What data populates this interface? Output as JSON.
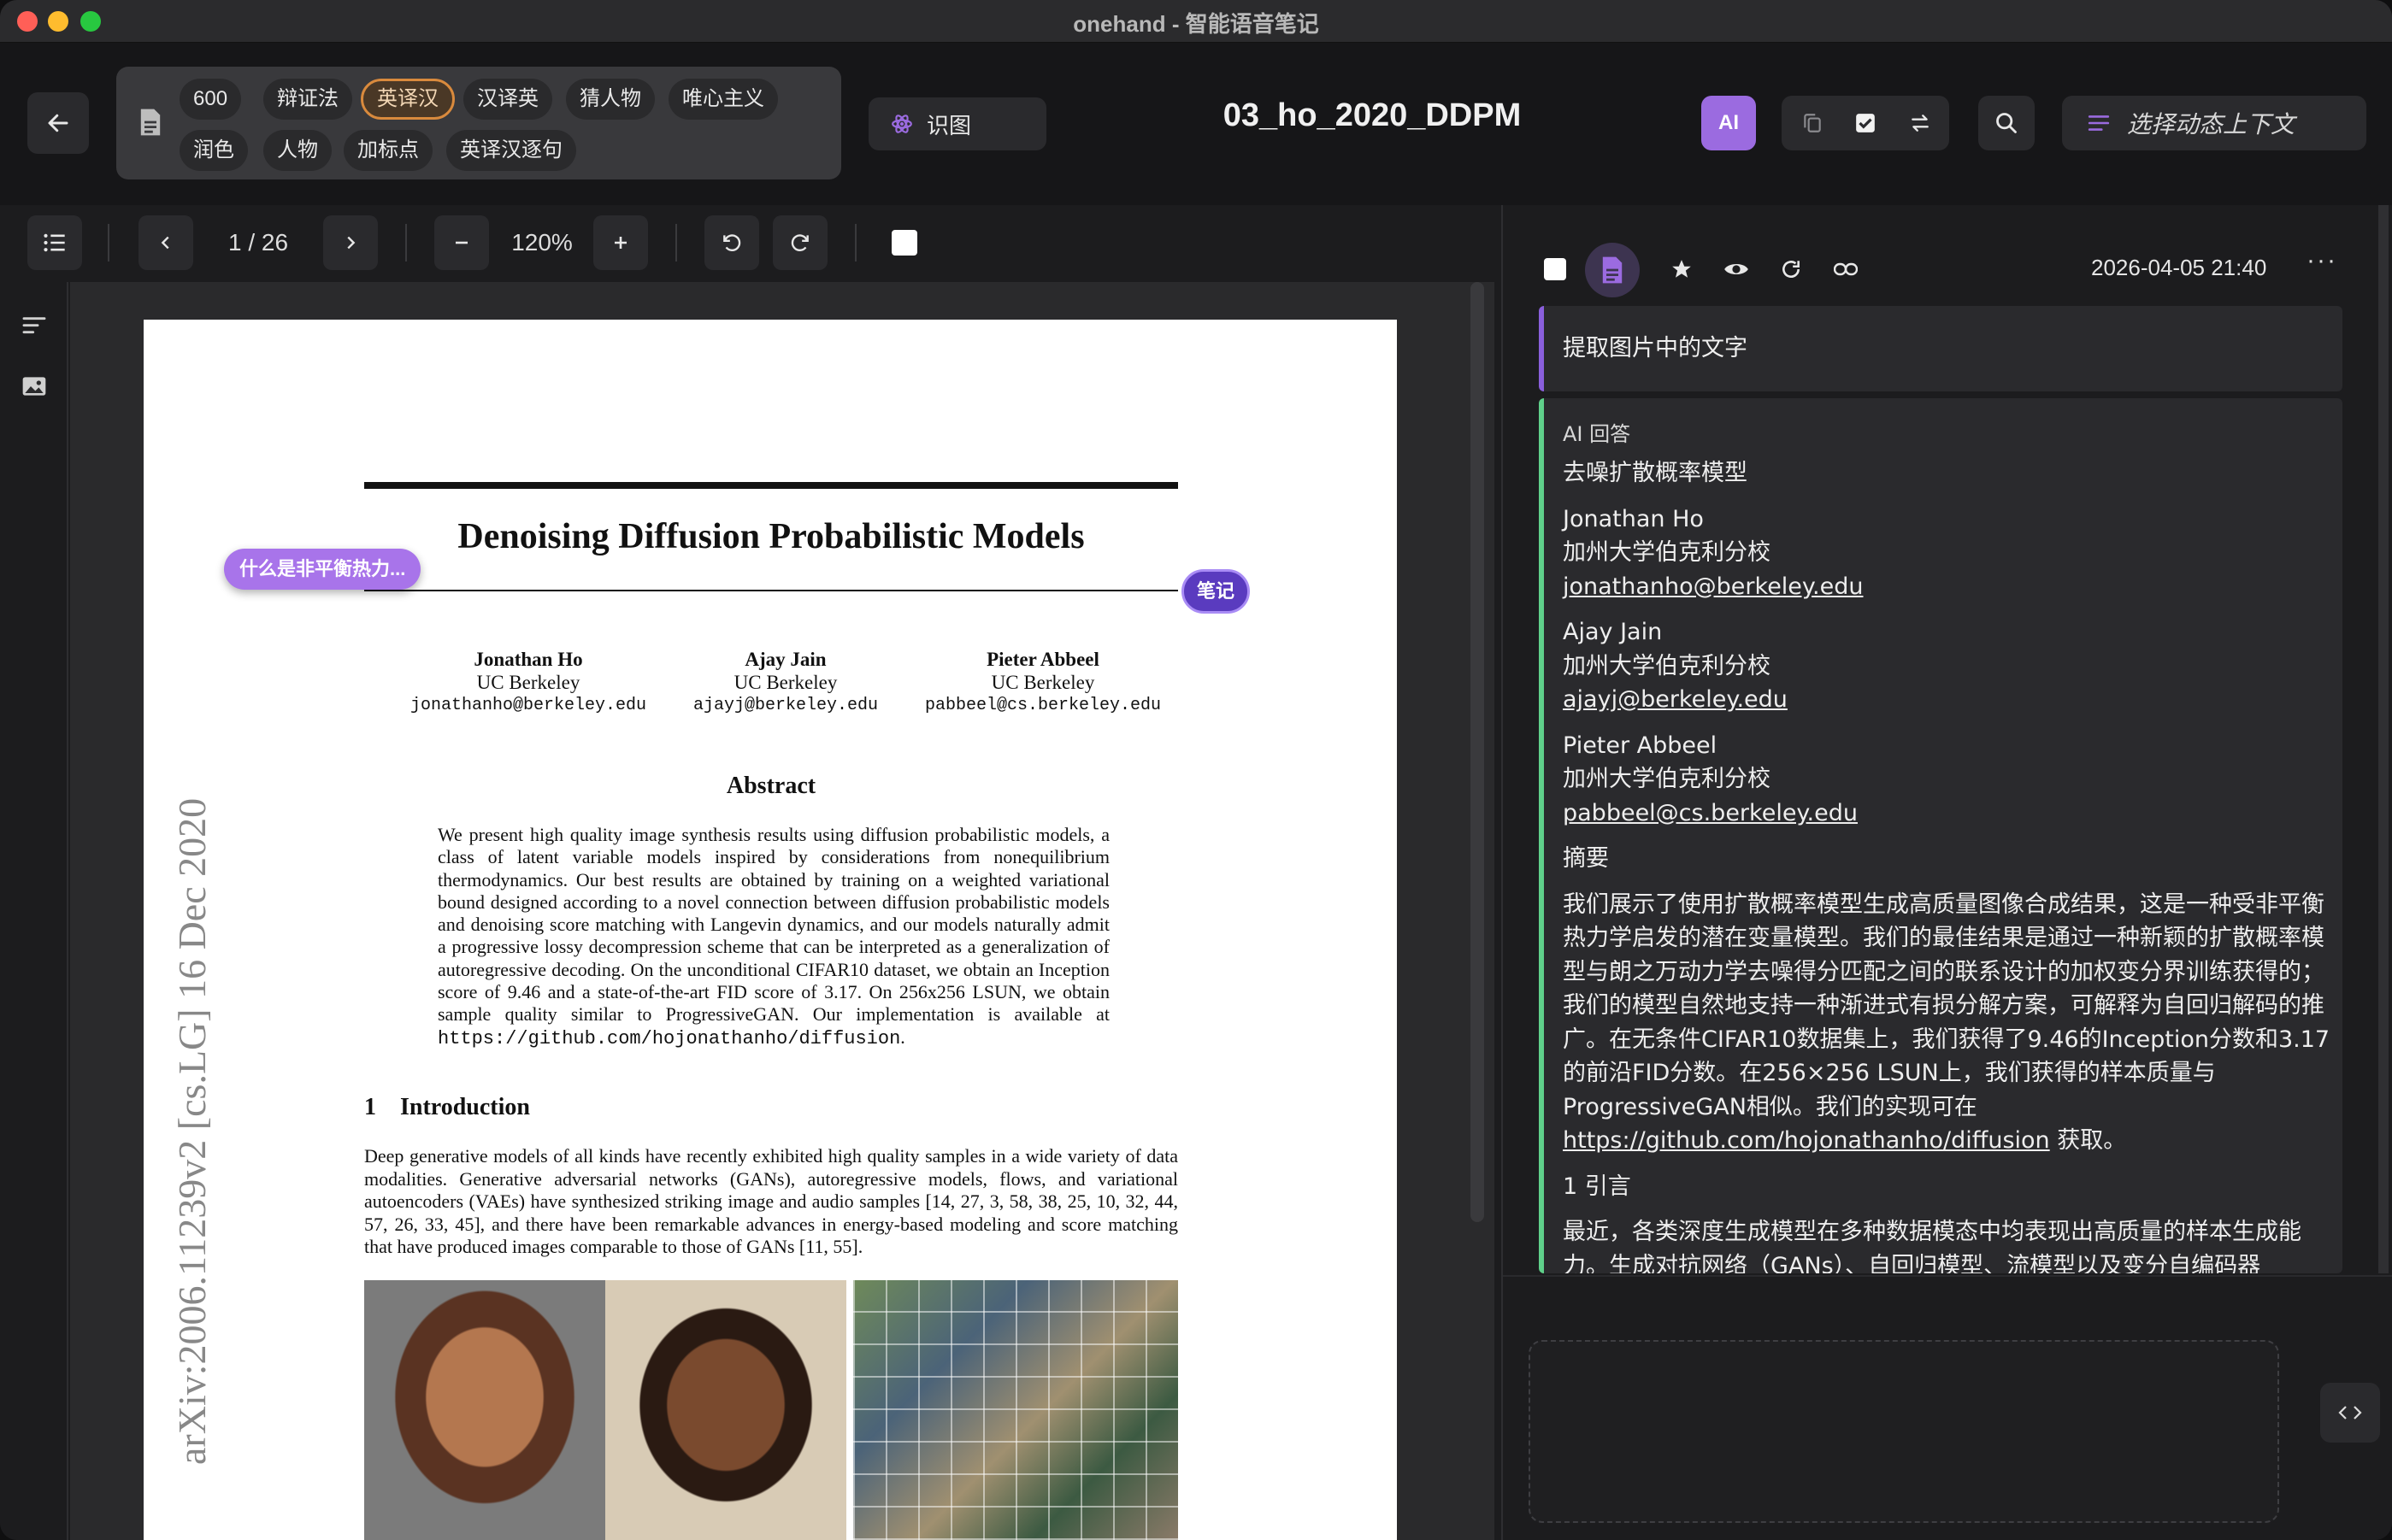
{
  "window": {
    "title": "onehand - 智能语音笔记"
  },
  "header": {
    "chips_row1": [
      "600",
      "辩证法",
      "英译汉",
      "汉译英",
      "猜人物",
      "唯心主义"
    ],
    "chips_row2": [
      "润色",
      "人物",
      "加标点",
      "英译汉逐句"
    ],
    "active_chip": "英译汉",
    "recog_label": "识图",
    "doc_title": "03_ho_2020_DDPM",
    "ai_label": "AI",
    "context_label": "选择动态上下文",
    "accent_color": "#9b6be0"
  },
  "pdf_toolbar": {
    "page_indicator": "1 / 26",
    "zoom": "120%"
  },
  "paper": {
    "title": "Denoising Diffusion Probabilistic Models",
    "authors": [
      {
        "name": "Jonathan Ho",
        "affil": "UC Berkeley",
        "email": "jonathanho@berkeley.edu"
      },
      {
        "name": "Ajay Jain",
        "affil": "UC Berkeley",
        "email": "ajayj@berkeley.edu"
      },
      {
        "name": "Pieter Abbeel",
        "affil": "UC Berkeley",
        "email": "pabbeel@cs.berkeley.edu"
      }
    ],
    "abstract_head": "Abstract",
    "abstract_text": "We present high quality image synthesis results using diffusion probabilistic models, a class of latent variable models inspired by considerations from nonequilibrium thermodynamics. Our best results are obtained by training on a weighted variational bound designed according to a novel connection between diffusion probabilistic models and denoising score matching with Langevin dynamics, and our models naturally admit a progressive lossy decompression scheme that can be interpreted as a generalization of autoregressive decoding. On the unconditional CIFAR10 dataset, we obtain an Inception score of 9.46 and a state-of-the-art FID score of 3.17. On 256x256 LSUN, we obtain sample quality similar to ProgressiveGAN. Our implementation is available at",
    "abstract_url": "https://github.com/hojonathanho/diffusion",
    "intro_head": "1    Introduction",
    "intro_text": "Deep generative models of all kinds have recently exhibited high quality samples in a wide variety of data modalities. Generative adversarial networks (GANs), autoregressive models, flows, and variational autoencoders (VAEs) have synthesized striking image and audio samples [14, 27, 3, 58, 38, 25, 10, 32, 44, 57, 26, 33, 45], and there have been remarkable advances in energy-based modeling and score matching that have produced images comparable to those of GANs [11, 55].",
    "arxiv_stamp": "arXiv:2006.11239v2  [cs.LG]  16 Dec 2020",
    "question_tag": "什么是非平衡热力...",
    "note_tag": "笔记"
  },
  "note_panel": {
    "timestamp": "2026-04-05 21:40",
    "more_label": "···",
    "prompt": "提取图片中的文字",
    "answer_label": "AI 回答",
    "answer": {
      "title": "去噪扩散概率模型",
      "author1_name": "Jonathan Ho",
      "author1_affil": "加州大学伯克利分校",
      "author1_email": "jonathanho@berkeley.edu",
      "author2_name": "Ajay Jain",
      "author2_affil": "加州大学伯克利分校",
      "author2_email": "ajayj@berkeley.edu",
      "author3_name": "Pieter Abbeel",
      "author3_affil": "加州大学伯克利分校",
      "author3_email": "pabbeel@cs.berkeley.edu",
      "abstract_head": "摘要",
      "abstract_text": "我们展示了使用扩散概率模型生成高质量图像合成结果，这是一种受非平衡热力学启发的潜在变量模型。我们的最佳结果是通过一种新颖的扩散概率模型与朗之万动力学去噪得分匹配之间的联系设计的加权变分界训练获得的；我们的模型自然地支持一种渐进式有损分解方案，可解释为自回归解码的推广。在无条件CIFAR10数据集上，我们获得了9.46的Inception分数和3.17的前沿FID分数。在256×256 LSUN上，我们获得的样本质量与ProgressiveGAN相似。我们的实现可在",
      "abstract_url": "https://github.com/hojonathanho/diffusion",
      "abstract_tail": " 获取。",
      "intro_head": "1 引言",
      "intro_text": "最近，各类深度生成模型在多种数据模态中均表现出高质量的样本生成能力。生成对抗网络（GANs）、自回归模型、流模型以及变分自编码器"
    }
  }
}
